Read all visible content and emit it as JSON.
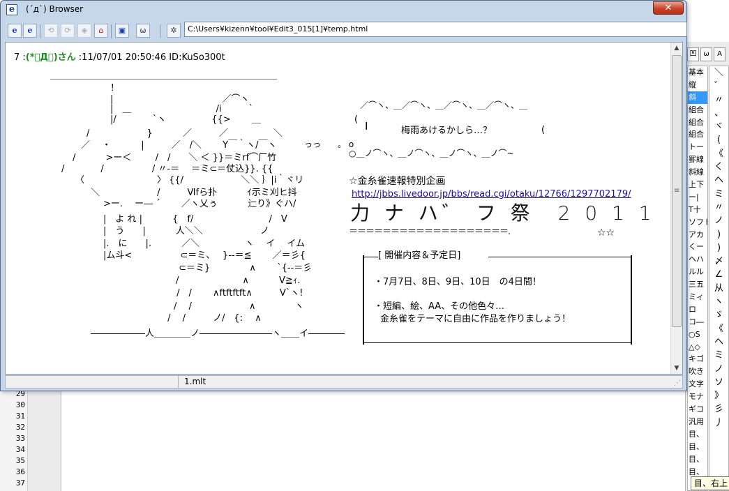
{
  "window": {
    "title": "(´д`) Browser",
    "close_label": "✕",
    "icon_letter": "e",
    "address": "C:\\Users¥kizenn¥tool¥Edit3_015[1]¥temp.html",
    "status_file": "1.mlt"
  },
  "toolbar": {
    "buttons": [
      {
        "name": "ie-open-button",
        "glyph": "e",
        "enabled": true
      },
      {
        "name": "ie-open-alt-button",
        "glyph": "e",
        "enabled": true
      },
      {
        "name": "back-button",
        "glyph": "⟲",
        "enabled": false
      },
      {
        "name": "forward-button",
        "glyph": "⟳",
        "enabled": false
      },
      {
        "name": "stop-button",
        "glyph": "◈",
        "enabled": false
      },
      {
        "name": "home-button",
        "glyph": "⌂",
        "enabled": true
      },
      {
        "name": "copy-button",
        "glyph": "▣",
        "enabled": true
      },
      {
        "name": "face-button",
        "glyph": "ω",
        "enabled": true
      },
      {
        "name": "settings-button",
        "glyph": "✲",
        "enabled": true
      }
    ]
  },
  "post": {
    "number": "7 :",
    "name": "(*゚Д゚)さん",
    "meta": " :11/07/01 20:50:46 ID:KuSo300t"
  },
  "art_lines": [
    "＿＿＿＿＿＿＿＿＿＿＿＿＿＿＿＿＿＿＿＿＿＿＿＿＿",
    "！",
    "|　　　　　　　　　　　　／⌒ヽ",
    "|　＿　　　　　　　　　 /i　　　`",
    "|/　　　　`ヽ　　　　　{{>　　 ＿",
    "/　　　　　　 }　　　 ／　　　／　　　　　＼",
    "／　 ・　　　 |　　　／　/＼　　 Y￣｀ヽ/￣ヽ",
    "/　　　 >ー＜ 　　 /　/　　＼ ＜ }}＝ミrf⌒厂竹",
    "/　　　　/　　　　　 / 〃-＝　 ＝ミ⊂＝仗込}}. {{",
    "〈　　　　　　　　〉 {{/　　　　　　 ＼＼ ｝|i｀ヾリ",
    "＼　　　　　　 /　　　Ⅵfら扑　　　 ｲ示ミ刈ヒ抖",
    ">ー.　 ー― ´　　 ／ヽ乂ぅ　　　 辷り》ぐハ/",
    "|　よ れ |　　　 {　f/　　　　　　　　 /　V",
    "|　う　　|　　　 人＼＼　　　　　　 ノ",
    "|.　に　　|.　　　 ／＼　　　　　ヽ　 イ　 イム",
    "|ム斗<　　　　　 ⊂＝ミ、　 }--＝≦　　 ／＝彡{",
    "　　　　　　　　 ⊂＝ミ}　　　　 ∧　　 `{--＝彡",
    "　　　　　　　　/　　　　　　　∧　　　 V≧ｨ.",
    "　　　　　　　 /　/　　 ∧ftftftft∧　　　V`ヽ!",
    "　　　　　　　/　 /　　　　　　 ∧　　　　 ヽ",
    "　　　　　　 /　 /　　　ノ/　{:　 ∧",
    "――――――人＿＿＿＿ノ――――――――ヽ＿＿イ――――"
  ],
  "bubble": {
    "top": "／⌒ヽ、＿／⌒ヽ、＿／⌒ヽ、＿／⌒ヽ、＿",
    "text": "梅雨あけるかしら…？",
    "cursor": "I",
    "bottom": "○＿ノ⌒ヽ、＿ノ⌒ヽ、＿ノ⌒ヽ、＿ノ⌒~",
    "dots": "っっ　　。 o"
  },
  "event": {
    "heading": "☆金糸雀速報特別企画",
    "link": "http://jbbs.livedoor.jp/bbs/read.cgi/otaku/12766/1297702179/",
    "banner": "力 ナ ハ゛ フ 祭　2 0 1 1",
    "underline": "＝＝＝＝＝＝＝＝＝＝＝＝＝＝＝＝＝＝＝.",
    "stars": "☆☆",
    "schedule_title": "[ 開催内容＆予定日]",
    "dates": "・7月7日、8日、9日、10日　の4日間！",
    "item1": "・短編、絵、AA、その他色々…",
    "item2": "金糸雀をテーマに自由に作品を作りましょう！"
  },
  "editor": {
    "line_numbers": [
      "29",
      "30",
      "31",
      "32",
      "33",
      "34",
      "35",
      "36",
      "37"
    ]
  },
  "palette": {
    "tabs": [
      "凹",
      "ω",
      "A"
    ],
    "categories": [
      "基本",
      "縦",
      "斜",
      "組合",
      "組合",
      "組合",
      "トー",
      "罫線",
      "斜線",
      "上下",
      "ー|",
      "T十",
      "ソフト",
      "アカ",
      "くー",
      "ヘハ",
      "ルル",
      "三五",
      "ミィ",
      "ロ",
      "コ―",
      "○S",
      "△◇",
      "キゴ",
      "吹き",
      "文字",
      "モナ",
      "ギコ",
      "汎用",
      "目、",
      "目、",
      "目、",
      "目、"
    ],
    "glyphs": [
      "＼",
      "゛",
      "〃",
      "、",
      "ヾ",
      "(",
      "《",
      "く",
      "ヘ",
      "ミ",
      "〃",
      "ノ",
      ")",
      ")",
      "〆",
      "∠",
      "从",
      "ヽ",
      "ゞ",
      "《",
      "ヘ",
      "ミ",
      "ノ",
      "ソ",
      "》",
      "彡",
      "丿"
    ],
    "tooltip": "目、右上"
  }
}
